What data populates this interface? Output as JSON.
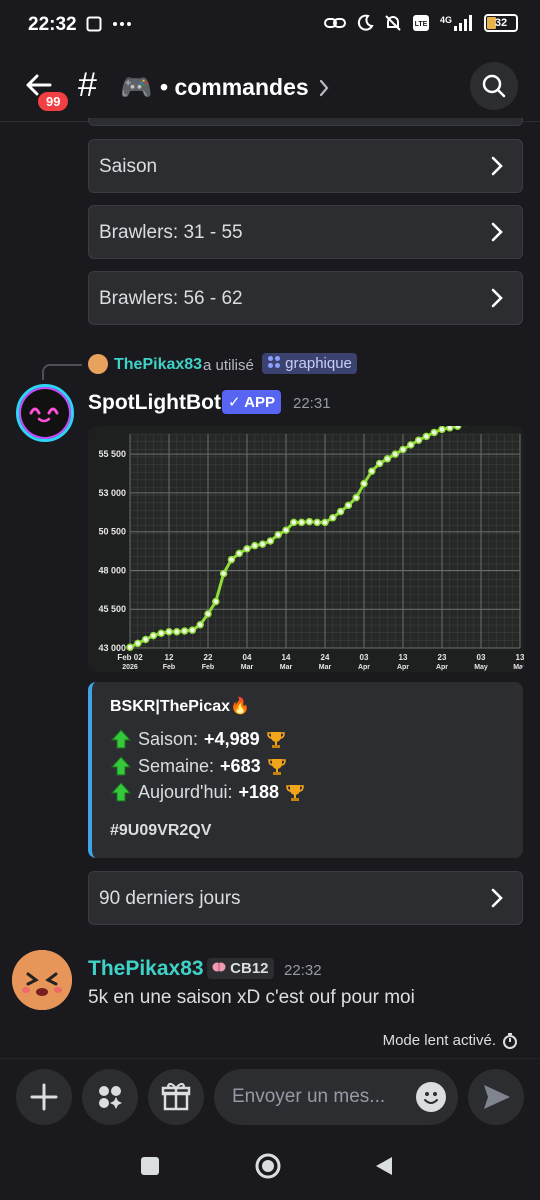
{
  "status_bar": {
    "time": "22:32",
    "battery": "32",
    "network": "4G"
  },
  "header": {
    "unread_badge": "99",
    "channel_prefix": "#",
    "channel_emoji": "🎮",
    "channel_name": "• commandes"
  },
  "menu_buttons": [
    {
      "label": "Saison"
    },
    {
      "label": "Brawlers: 31 - 55"
    },
    {
      "label": "Brawlers: 56 - 62"
    }
  ],
  "reply": {
    "user": "ThePikax83",
    "used_text": "a utilisé",
    "command": "graphique"
  },
  "bot_message": {
    "name": "SpotLightBot",
    "app_badge": "✓ APP",
    "time": "22:31"
  },
  "chart_data": {
    "type": "line",
    "y_ticks": [
      "43 000",
      "45 500",
      "48 000",
      "50 500",
      "53 000",
      "55 500"
    ],
    "ylim": [
      43000,
      56800
    ],
    "x_ticks": [
      {
        "label": "Feb 02",
        "sub": "2026"
      },
      {
        "label": "12",
        "sub": "Feb"
      },
      {
        "label": "22",
        "sub": "Feb"
      },
      {
        "label": "04",
        "sub": "Mar"
      },
      {
        "label": "14",
        "sub": "Mar"
      },
      {
        "label": "24",
        "sub": "Mar"
      },
      {
        "label": "03",
        "sub": "Apr"
      },
      {
        "label": "13",
        "sub": "Apr"
      },
      {
        "label": "23",
        "sub": "Apr"
      },
      {
        "label": "03",
        "sub": "May"
      },
      {
        "label": "13",
        "sub": "May"
      }
    ],
    "x": [
      "2026-02-02",
      "2026-02-04",
      "2026-02-06",
      "2026-02-08",
      "2026-02-10",
      "2026-02-12",
      "2026-02-14",
      "2026-02-16",
      "2026-02-18",
      "2026-02-20",
      "2026-02-22",
      "2026-02-24",
      "2026-02-26",
      "2026-02-28",
      "2026-03-02",
      "2026-03-04",
      "2026-03-06",
      "2026-03-08",
      "2026-03-10",
      "2026-03-12",
      "2026-03-14",
      "2026-03-16",
      "2026-03-18",
      "2026-03-20",
      "2026-03-22",
      "2026-03-24",
      "2026-03-26",
      "2026-03-28",
      "2026-03-30",
      "2026-04-01",
      "2026-04-03",
      "2026-04-05",
      "2026-04-07",
      "2026-04-09",
      "2026-04-11",
      "2026-04-13",
      "2026-04-15",
      "2026-04-17",
      "2026-04-19",
      "2026-04-21",
      "2026-04-23",
      "2026-04-25",
      "2026-04-27",
      "2026-04-29",
      "2026-05-01"
    ],
    "values": [
      43050,
      43300,
      43550,
      43800,
      43950,
      44050,
      44050,
      44100,
      44150,
      44500,
      45200,
      46000,
      47800,
      48700,
      49100,
      49400,
      49600,
      49700,
      49900,
      50300,
      50600,
      51100,
      51100,
      51150,
      51100,
      51100,
      51400,
      51800,
      52200,
      52700,
      53600,
      54400,
      54900,
      55200,
      55500,
      55800,
      56100,
      56400,
      56650,
      56900,
      57100,
      57200,
      57300,
      57550,
      57750
    ],
    "line_color": "#8fdc3a",
    "grid": true
  },
  "embed": {
    "author": "BSKR|ThePicax🔥",
    "lines": [
      {
        "label": "Saison:",
        "value": "+4,989"
      },
      {
        "label": "Semaine:",
        "value": "+683"
      },
      {
        "label": "Aujourd'hui:",
        "value": "+188"
      }
    ],
    "tag": "#9U09VR2QV",
    "accent_color": "#3ea4e6"
  },
  "period_button": {
    "label": "90 derniers jours"
  },
  "user_message": {
    "name": "ThePikax83",
    "clan": "CB12",
    "time": "22:32",
    "text": "5k en une saison xD c'est ouf pour moi"
  },
  "slow_mode": "Mode lent activé.",
  "composer": {
    "placeholder": "Envoyer un mes..."
  }
}
